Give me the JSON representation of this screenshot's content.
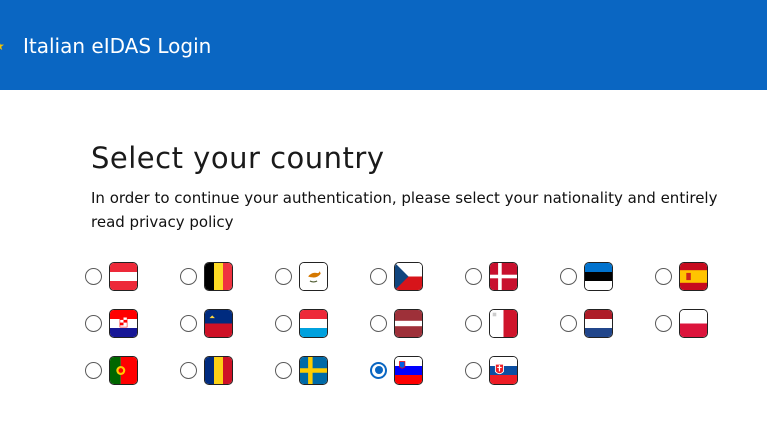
{
  "header": {
    "title": "Italian eIDAS Login"
  },
  "main": {
    "title": "Select your country",
    "subtitle": "In order to continue your authentication, please select your nationality and entirely read privacy policy"
  },
  "countries": [
    {
      "code": "AT",
      "flag_icon": "austria-flag-icon",
      "selected": false
    },
    {
      "code": "BE",
      "flag_icon": "belgium-flag-icon",
      "selected": false
    },
    {
      "code": "CY",
      "flag_icon": "cyprus-flag-icon",
      "selected": false
    },
    {
      "code": "CZ",
      "flag_icon": "czech-flag-icon",
      "selected": false
    },
    {
      "code": "DK",
      "flag_icon": "denmark-flag-icon",
      "selected": false
    },
    {
      "code": "EE",
      "flag_icon": "estonia-flag-icon",
      "selected": false
    },
    {
      "code": "ES",
      "flag_icon": "spain-flag-icon",
      "selected": false
    },
    {
      "code": "HR",
      "flag_icon": "croatia-flag-icon",
      "selected": false
    },
    {
      "code": "LI",
      "flag_icon": "liechtenstein-flag-icon",
      "selected": false
    },
    {
      "code": "LU",
      "flag_icon": "luxembourg-flag-icon",
      "selected": false
    },
    {
      "code": "LV",
      "flag_icon": "latvia-flag-icon",
      "selected": false
    },
    {
      "code": "MT",
      "flag_icon": "malta-flag-icon",
      "selected": false
    },
    {
      "code": "NL",
      "flag_icon": "netherlands-flag-icon",
      "selected": false
    },
    {
      "code": "PL",
      "flag_icon": "poland-flag-icon",
      "selected": false
    },
    {
      "code": "PT",
      "flag_icon": "portugal-flag-icon",
      "selected": false
    },
    {
      "code": "RO",
      "flag_icon": "romania-flag-icon",
      "selected": false
    },
    {
      "code": "SE",
      "flag_icon": "sweden-flag-icon",
      "selected": false
    },
    {
      "code": "SI",
      "flag_icon": "slovenia-flag-icon",
      "selected": true
    },
    {
      "code": "SK",
      "flag_icon": "slovakia-flag-icon",
      "selected": false
    }
  ],
  "colors": {
    "header_bg": "#0a66c2",
    "radio_selected": "#0a66c2"
  }
}
